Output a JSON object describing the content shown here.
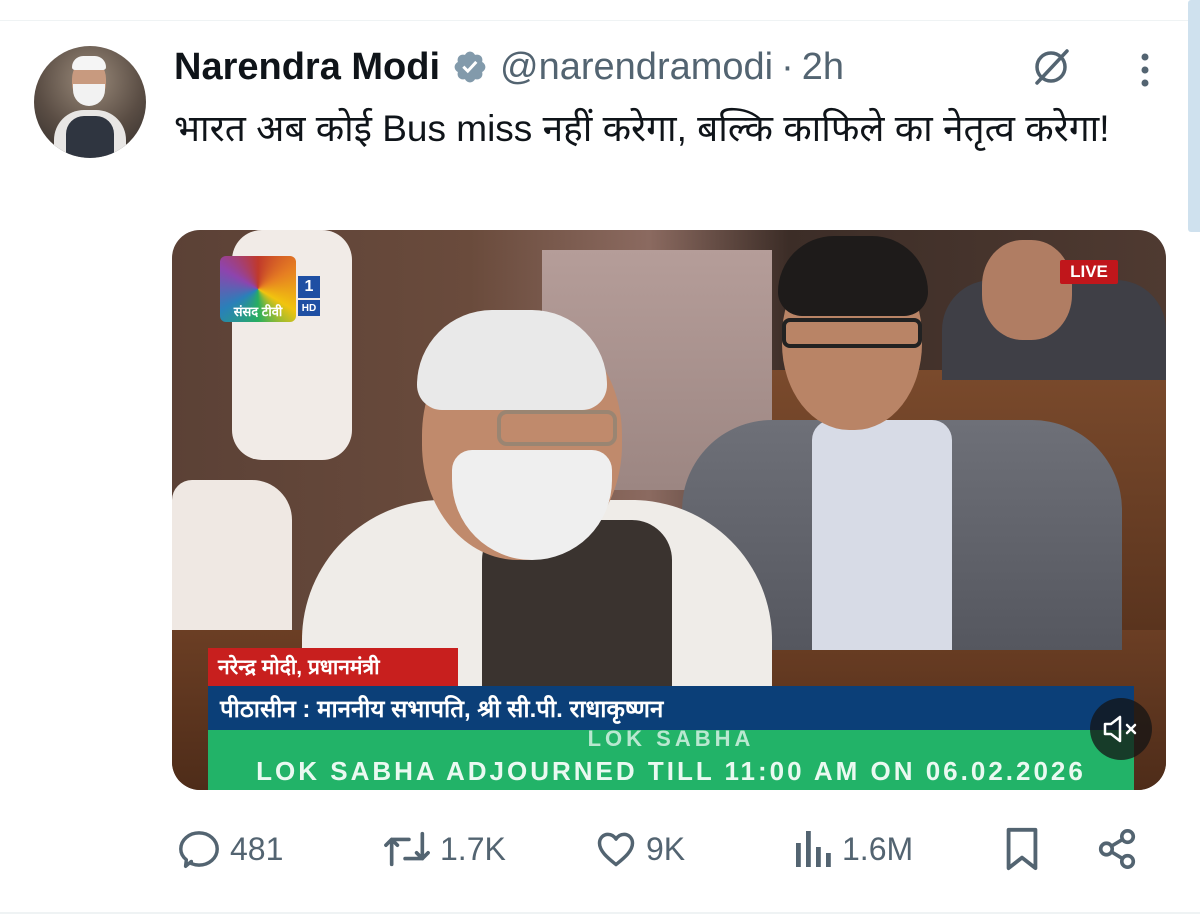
{
  "author": {
    "name": "Narendra Modi",
    "handle": "@narendramodi",
    "separator": "·",
    "time": "2h",
    "verified_icon": "verified-badge-icon"
  },
  "tweet": {
    "text": "भारत अब कोई Bus miss नहीं करेगा, बल्कि काफिले का नेतृत्व करेगा!"
  },
  "media": {
    "channel_logo_text": "संसद टीवी",
    "channel_number": "1",
    "channel_hd": "HD",
    "live_label": "LIVE",
    "speaker_caption": "नरेन्द्र मोदी, प्रधानमंत्री",
    "chair_caption": "पीठासीन : माननीय सभापति, श्री सी.पी. राधाकृष्णन",
    "ticker_top": "LOK SABHA",
    "ticker_text": "LOK SABHA ADJOURNED TILL 11:00 AM ON 06.02.2026",
    "mute_icon": "speaker-muted-icon"
  },
  "actions": {
    "replies": "481",
    "reposts": "1.7K",
    "likes": "9K",
    "views": "1.6M"
  },
  "colors": {
    "text_primary": "#0f1419",
    "text_secondary": "#536471",
    "verified": "#829aab",
    "live_red": "#c0161b",
    "caption_red": "#c81f1e",
    "caption_blue": "#0b3f78",
    "ticker_green": "#22b368"
  }
}
